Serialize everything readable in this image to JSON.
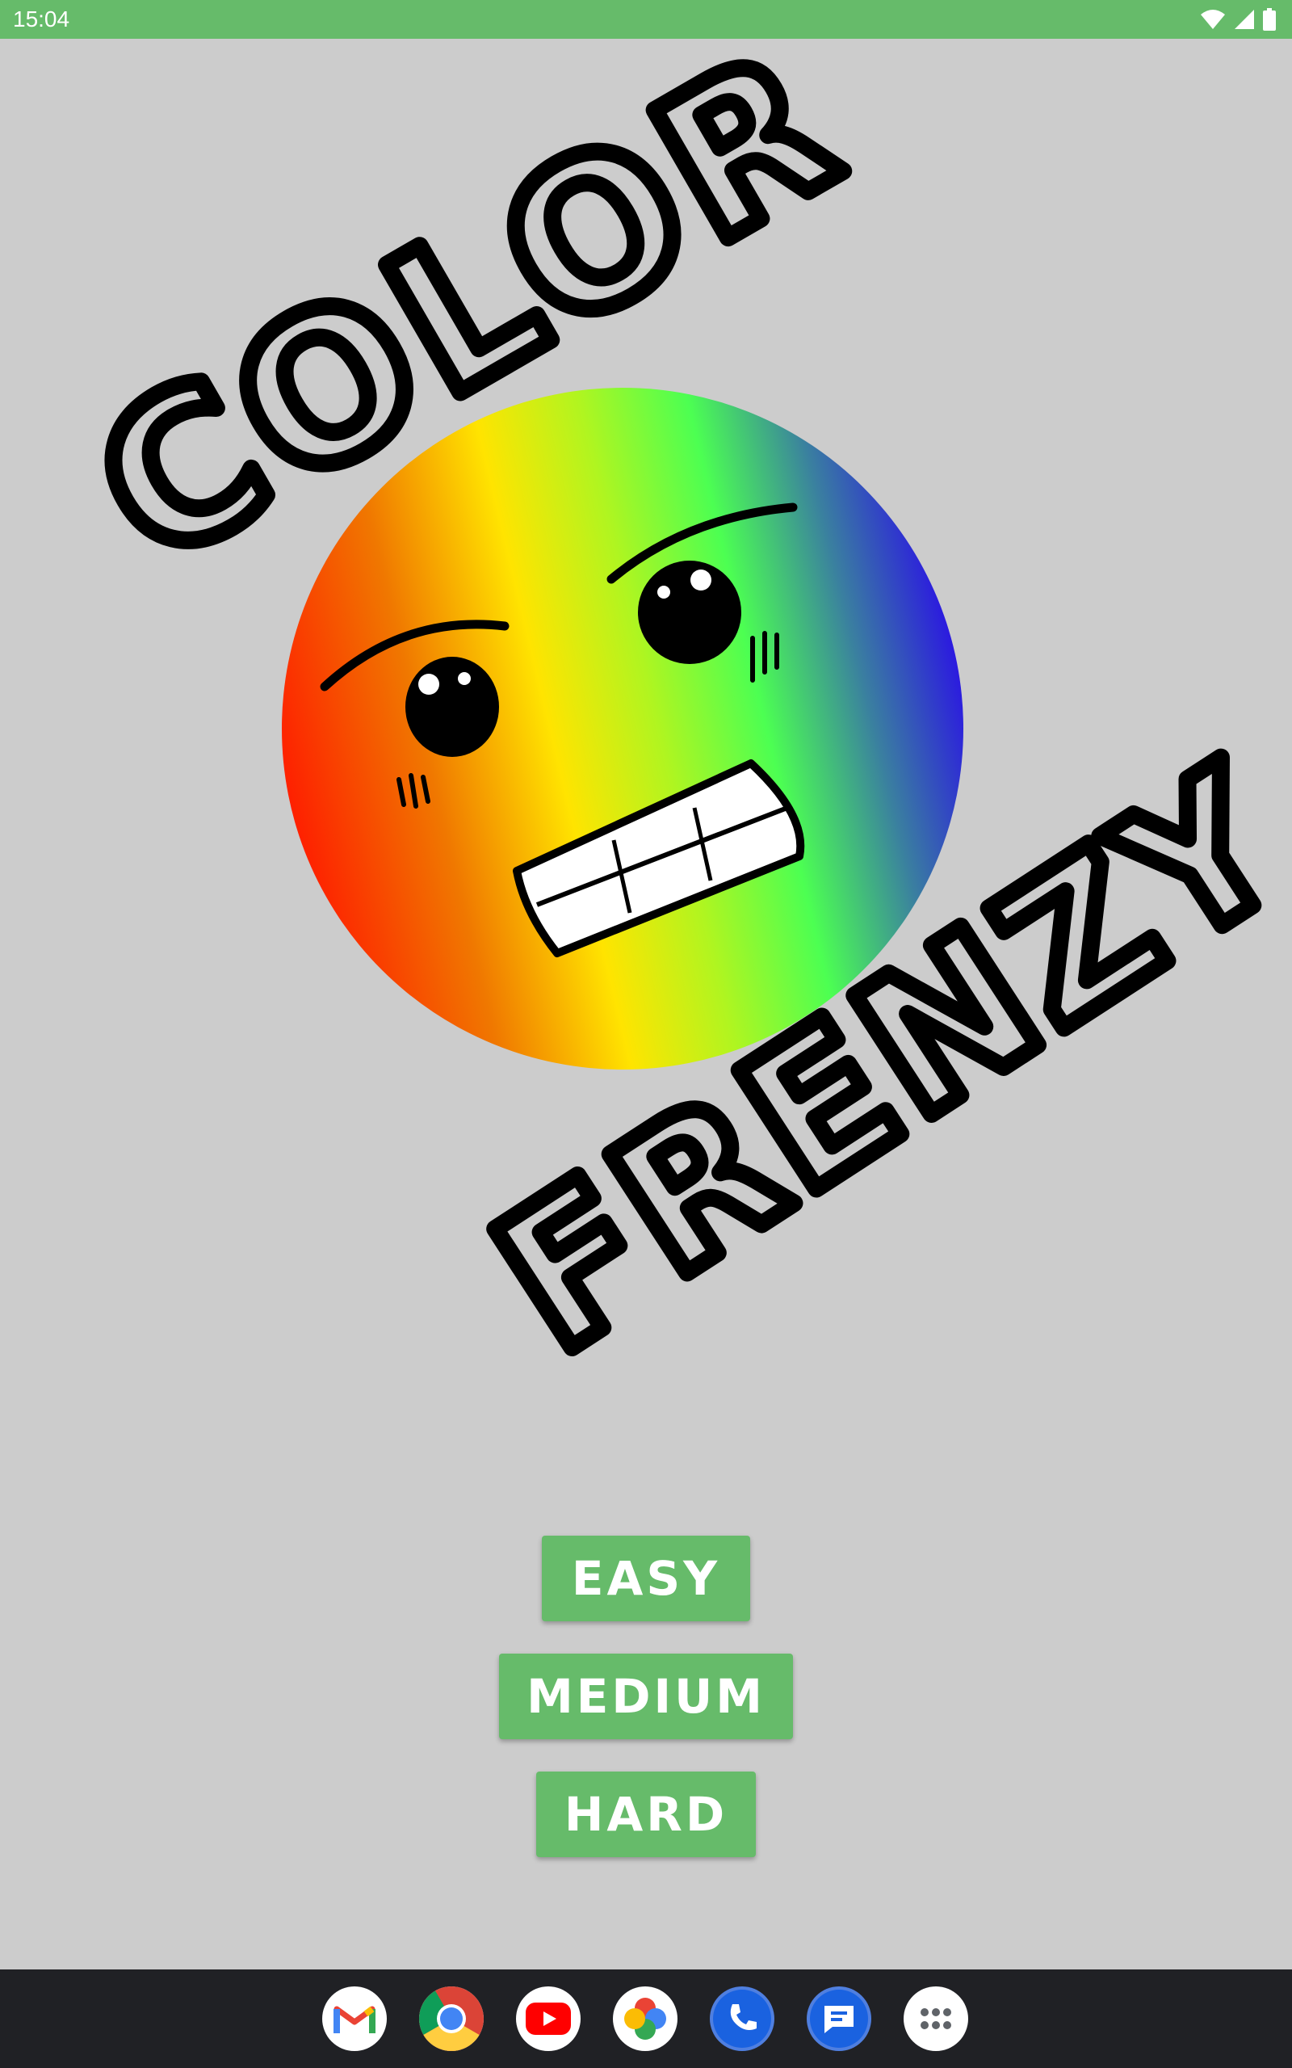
{
  "status_bar": {
    "time": "15:04",
    "icons": [
      "wifi-icon",
      "signal-icon",
      "battery-icon"
    ],
    "color": "#66bb6a"
  },
  "logo": {
    "word_top": "COLOR",
    "word_bottom": "FRENZY",
    "face_colors": [
      "#ff1a00",
      "#ffe400",
      "#e6f500",
      "#4cff52",
      "#2a10e6"
    ]
  },
  "menu": {
    "easy_label": "EASY",
    "medium_label": "MEDIUM",
    "hard_label": "HARD",
    "button_color": "#66bb6a",
    "background_color": "#cccccc"
  },
  "dock": {
    "apps": [
      "gmail-icon",
      "chrome-icon",
      "youtube-icon",
      "photos-icon",
      "phone-icon",
      "messages-icon",
      "app-drawer-icon"
    ]
  }
}
